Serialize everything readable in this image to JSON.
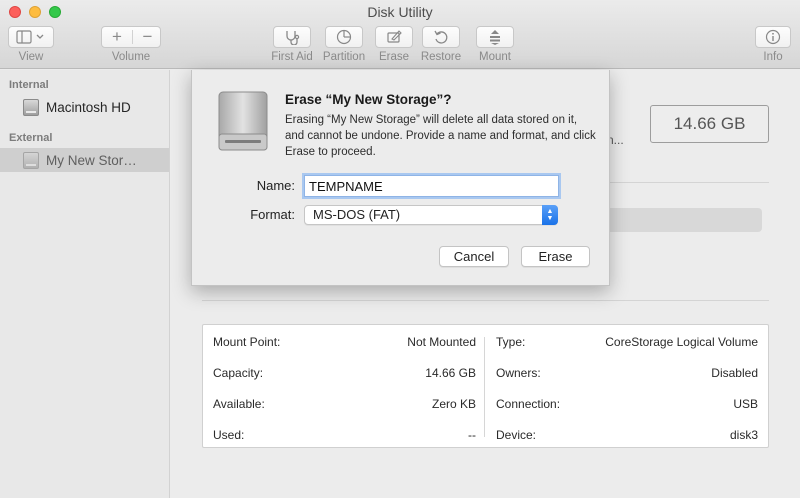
{
  "window": {
    "title": "Disk Utility"
  },
  "toolbar": {
    "view_label": "View",
    "volume_label": "Volume",
    "first_aid_label": "First Aid",
    "partition_label": "Partition",
    "erase_label": "Erase",
    "restore_label": "Restore",
    "mount_label": "Mount",
    "info_label": "Info",
    "icons": [
      "sidebar-toggle-icon",
      "plus-icon",
      "minus-icon",
      "stethoscope-icon",
      "pie-chart-icon",
      "erase-icon",
      "restore-icon",
      "mount-icon",
      "info-icon"
    ]
  },
  "sidebar": {
    "internal_header": "Internal",
    "internal_items": [
      {
        "label": "Macintosh HD"
      }
    ],
    "external_header": "External",
    "external_items": [
      {
        "label": "My New Stor…"
      }
    ]
  },
  "main": {
    "size": "14.66 GB",
    "partial_text": "n..."
  },
  "info": {
    "left": [
      {
        "label": "Mount Point:",
        "value": "Not Mounted"
      },
      {
        "label": "Capacity:",
        "value": "14.66 GB"
      },
      {
        "label": "Available:",
        "value": "Zero KB"
      },
      {
        "label": "Used:",
        "value": "--"
      }
    ],
    "right": [
      {
        "label": "Type:",
        "value": "CoreStorage Logical Volume"
      },
      {
        "label": "Owners:",
        "value": "Disabled"
      },
      {
        "label": "Connection:",
        "value": "USB"
      },
      {
        "label": "Device:",
        "value": "disk3"
      }
    ]
  },
  "sheet": {
    "title": "Erase “My New Storage”?",
    "message": "Erasing “My New Storage” will delete all data stored on it, and cannot be undone. Provide a name and format, and click Erase to proceed.",
    "name_label": "Name:",
    "name_value": "TEMPNAME",
    "format_label": "Format:",
    "format_value": "MS-DOS (FAT)",
    "cancel_label": "Cancel",
    "erase_label": "Erase"
  },
  "colors": {
    "accent": "#1a72e8",
    "focus_ring": "#a9c8f0",
    "close": "#fc605c",
    "minimize": "#fdbc40",
    "zoom": "#34c84a"
  }
}
